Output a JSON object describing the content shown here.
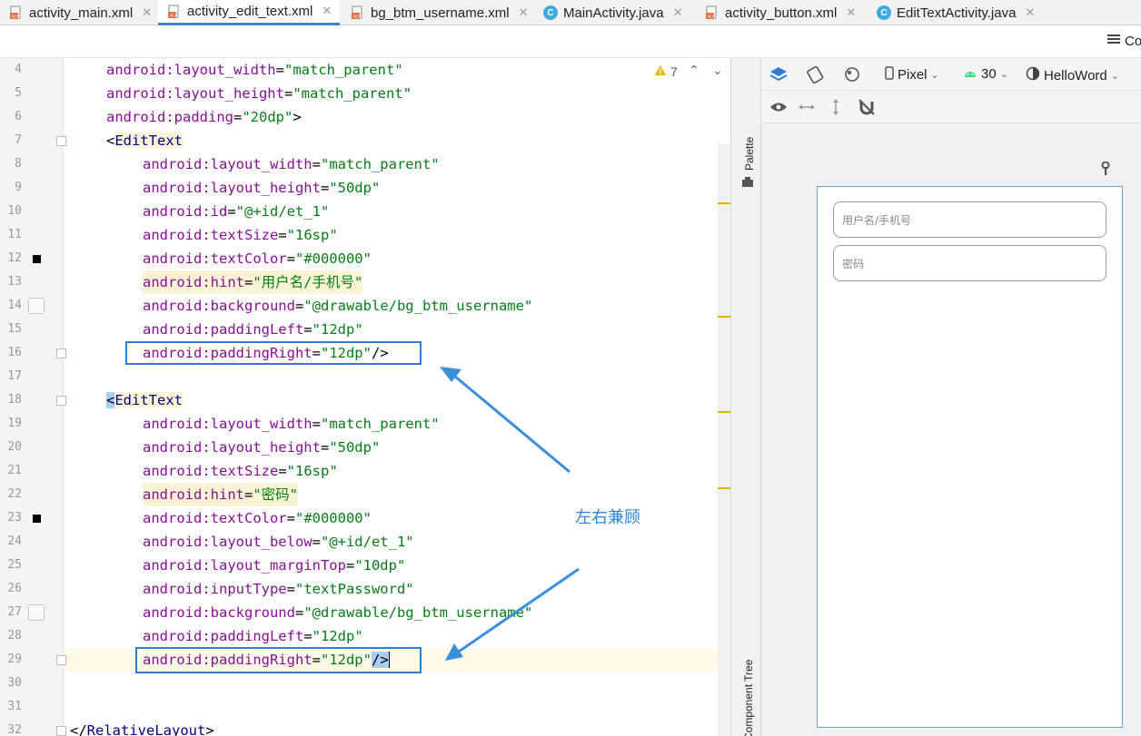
{
  "tabs": [
    {
      "label": "activity_main.xml",
      "type": "xml",
      "active": false
    },
    {
      "label": "activity_edit_text.xml",
      "type": "xml",
      "active": true
    },
    {
      "label": "bg_btm_username.xml",
      "type": "xml",
      "active": false
    },
    {
      "label": "MainActivity.java",
      "type": "java",
      "active": false
    },
    {
      "label": "activity_button.xml",
      "type": "xml",
      "active": false
    },
    {
      "label": "EditTextActivity.java",
      "type": "java",
      "active": false
    }
  ],
  "toolbar": {
    "code_label": "Co"
  },
  "editor": {
    "warning_count": "7",
    "lines": [
      {
        "n": "4"
      },
      {
        "n": "5"
      },
      {
        "n": "6"
      },
      {
        "n": "7"
      },
      {
        "n": "8"
      },
      {
        "n": "9"
      },
      {
        "n": "10"
      },
      {
        "n": "11"
      },
      {
        "n": "12"
      },
      {
        "n": "13"
      },
      {
        "n": "14"
      },
      {
        "n": "15"
      },
      {
        "n": "16"
      },
      {
        "n": "17"
      },
      {
        "n": "18"
      },
      {
        "n": "19"
      },
      {
        "n": "20"
      },
      {
        "n": "21"
      },
      {
        "n": "22"
      },
      {
        "n": "23"
      },
      {
        "n": "24"
      },
      {
        "n": "25"
      },
      {
        "n": "26"
      },
      {
        "n": "27"
      },
      {
        "n": "28"
      },
      {
        "n": "29"
      },
      {
        "n": "30"
      },
      {
        "n": "31"
      },
      {
        "n": "32"
      }
    ],
    "code": {
      "l4_attr": "android:layout_width",
      "l4_val": "\"match_parent\"",
      "l5_attr": "android:layout_height",
      "l5_val": "\"match_parent\"",
      "l6_attr": "android:padding",
      "l6_val": "\"20dp\"",
      "l7_tag": "EditText",
      "l8_attr": "android:layout_width",
      "l8_val": "\"match_parent\"",
      "l9_attr": "android:layout_height",
      "l9_val": "\"50dp\"",
      "l10_attr": "android:id",
      "l10_val": "\"@+id/et_1\"",
      "l11_attr": "android:textSize",
      "l11_val": "\"16sp\"",
      "l12_attr": "android:textColor",
      "l12_val": "\"#000000\"",
      "l13_attr": "android:hint",
      "l13_val": "\"用户名/手机号\"",
      "l14_attr": "android:background",
      "l14_val": "\"@drawable/bg_btm_username\"",
      "l15_attr": "android:paddingLeft",
      "l15_val": "\"12dp\"",
      "l16_attr": "android:paddingRight",
      "l16_val": "\"12dp\"",
      "l18_tag": "EditText",
      "l19_attr": "android:layout_width",
      "l19_val": "\"match_parent\"",
      "l20_attr": "android:layout_height",
      "l20_val": "\"50dp\"",
      "l21_attr": "android:textSize",
      "l21_val": "\"16sp\"",
      "l22_attr": "android:hint",
      "l22_val": "\"密码\"",
      "l23_attr": "android:textColor",
      "l23_val": "\"#000000\"",
      "l24_attr": "android:layout_below",
      "l24_val": "\"@+id/et_1\"",
      "l25_attr": "android:layout_marginTop",
      "l25_val": "\"10dp\"",
      "l26_attr": "android:inputType",
      "l26_val": "\"textPassword\"",
      "l27_attr": "android:background",
      "l27_val": "\"@drawable/bg_btm_username\"",
      "l28_attr": "android:paddingLeft",
      "l28_val": "\"12dp\"",
      "l29_attr": "android:paddingRight",
      "l29_val": "\"12dp\"",
      "l32_tag": "RelativeLayout"
    }
  },
  "annotation": {
    "text": "左右兼顾"
  },
  "side_panel": {
    "palette_label": "Palette",
    "component_tree_label": "Component Tree"
  },
  "design_toolbar": {
    "device": "Pixel",
    "api": "30",
    "theme": "HelloWord"
  },
  "preview": {
    "field1_hint": "用户名/手机号",
    "field2_hint": "密码"
  },
  "colors": {
    "accent": "#4083c9",
    "annotation": "#2f86d6",
    "attr": "#871094",
    "string": "#067d17",
    "tag": "#000080"
  }
}
